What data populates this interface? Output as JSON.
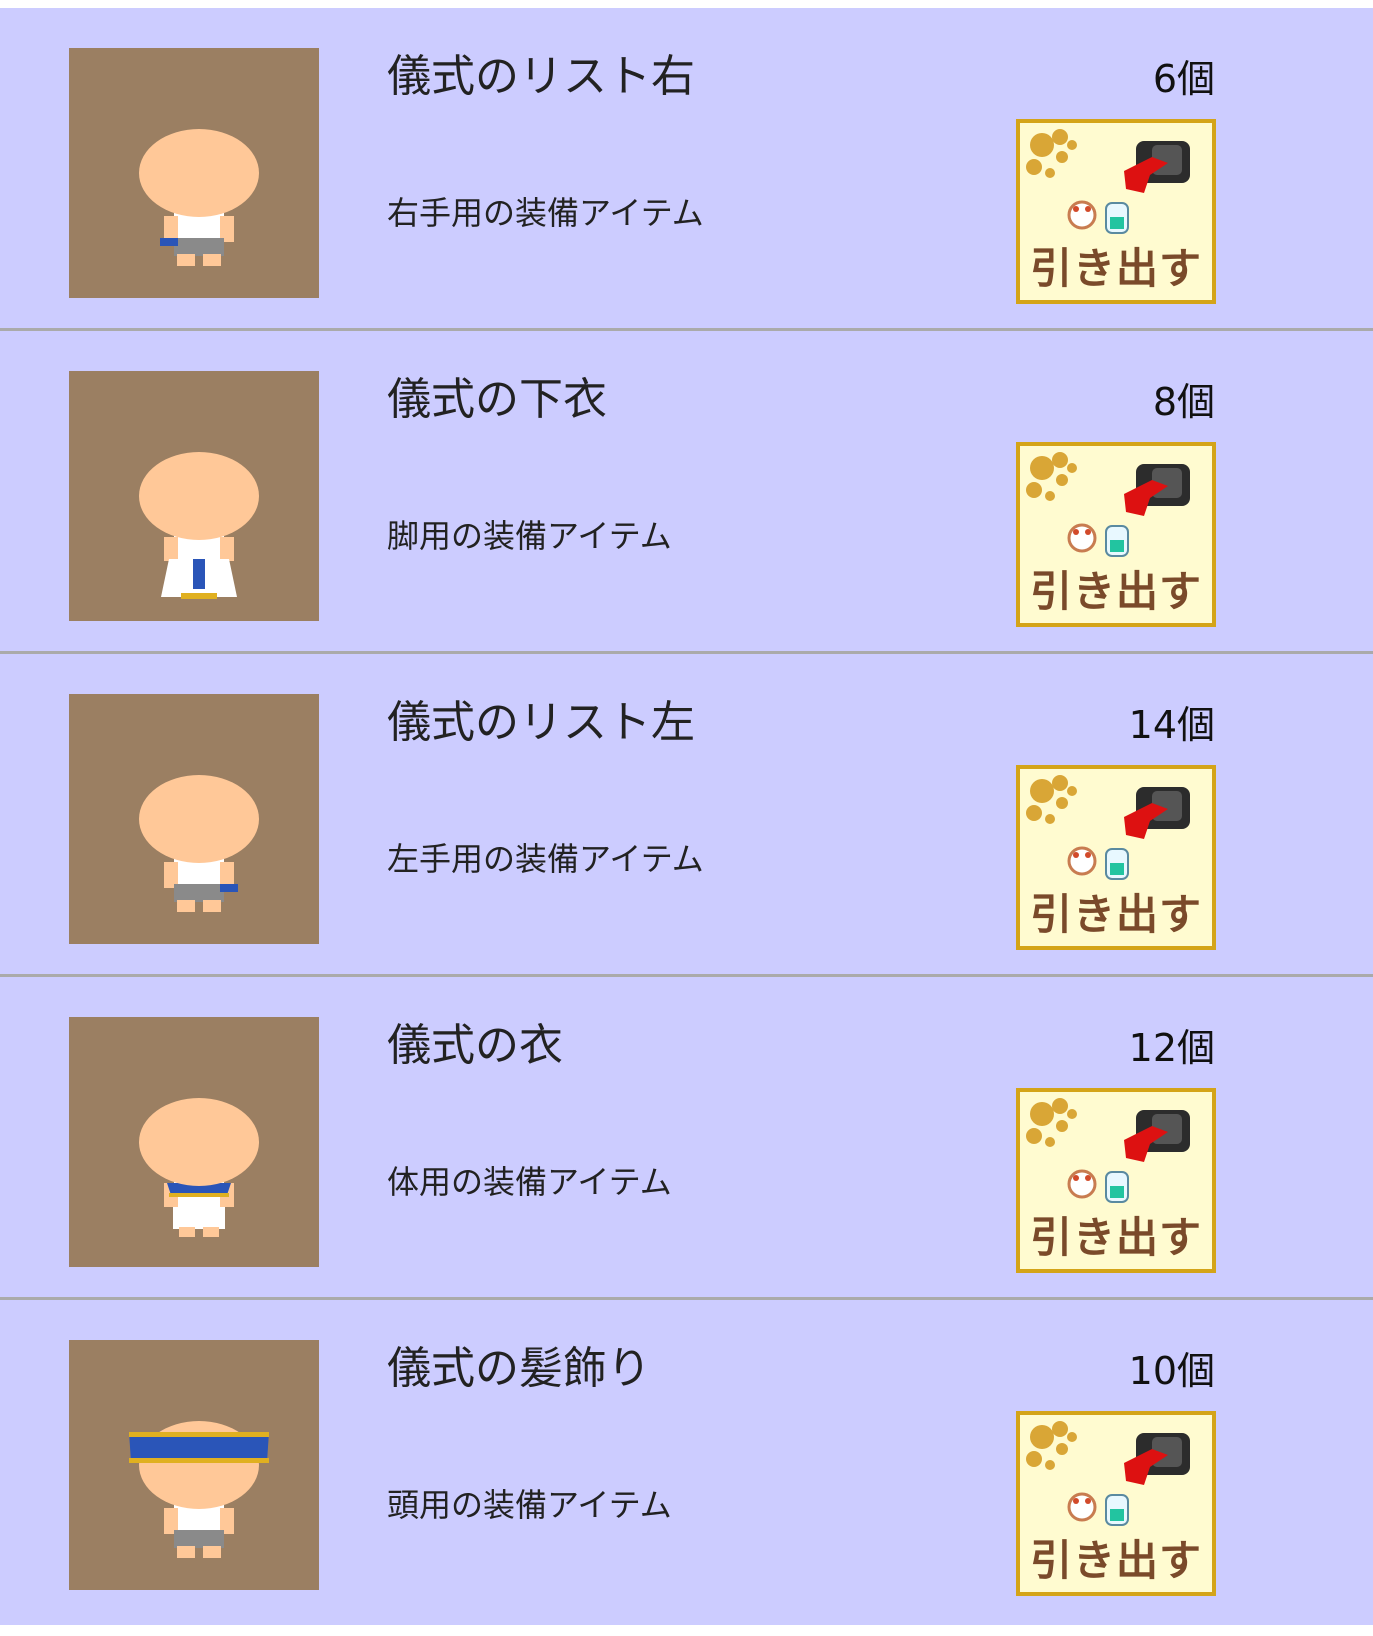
{
  "items": [
    {
      "name": "儀式のリスト右",
      "description": "右手用の装備アイテム",
      "count": "6個",
      "button_label": "引き出す",
      "avatar_gear": "wrist-right"
    },
    {
      "name": "儀式の下衣",
      "description": "脚用の装備アイテム",
      "count": "8個",
      "button_label": "引き出す",
      "avatar_gear": "lower-garment"
    },
    {
      "name": "儀式のリスト左",
      "description": "左手用の装備アイテム",
      "count": "14個",
      "button_label": "引き出す",
      "avatar_gear": "wrist-left"
    },
    {
      "name": "儀式の衣",
      "description": "体用の装備アイテム",
      "count": "12個",
      "button_label": "引き出す",
      "avatar_gear": "robe"
    },
    {
      "name": "儀式の髪飾り",
      "description": "頭用の装備アイテム",
      "count": "10個",
      "button_label": "引き出す",
      "avatar_gear": "headband"
    }
  ],
  "colors": {
    "row_background": "#ccccff",
    "row_divider": "#aaaaaa",
    "thumbnail_background": "#9b7f62",
    "skin": "#ffc898",
    "gear_blue": "#2a55b8",
    "gear_gold": "#e0b020",
    "button_background": "#fffbd0",
    "button_border": "#d4a418",
    "button_text": "#7a4a2a"
  },
  "icons": {
    "thumbnail": "avatar-sprite-icon",
    "button": "withdraw-arrow-icon"
  }
}
